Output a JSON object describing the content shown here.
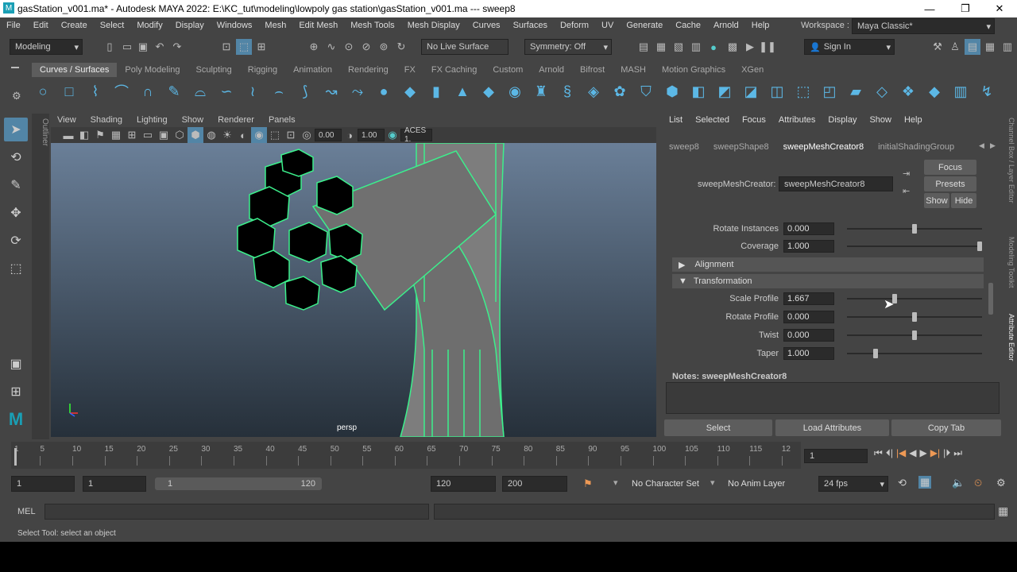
{
  "window": {
    "title": "gasStation_v001.ma* - Autodesk MAYA 2022: E:\\KC_tut\\modeling\\lowpoly gas station\\gasStation_v001.ma  ---  sweep8",
    "minimize": "—",
    "maximize": "❐",
    "close": "✕"
  },
  "menubar": [
    "File",
    "Edit",
    "Create",
    "Select",
    "Modify",
    "Display",
    "Windows",
    "Mesh",
    "Edit Mesh",
    "Mesh Tools",
    "Mesh Display",
    "Curves",
    "Surfaces",
    "Deform",
    "UV",
    "Generate",
    "Cache",
    "Arnold",
    "Help"
  ],
  "workspace": {
    "label": "Workspace :",
    "value": "Maya Classic*"
  },
  "statusline": {
    "menuset": "Modeling",
    "live_surface": "No Live Surface",
    "symmetry": "Symmetry: Off",
    "sign_in": "Sign In"
  },
  "shelf": {
    "tabs": [
      "Curves / Surfaces",
      "Poly Modeling",
      "Sculpting",
      "Rigging",
      "Animation",
      "Rendering",
      "FX",
      "FX Caching",
      "Custom",
      "Arnold",
      "Bifrost",
      "MASH",
      "Motion Graphics",
      "XGen"
    ],
    "active_tab": 0
  },
  "toolbox": {
    "tools": [
      "select-tool",
      "lasso-tool",
      "paint-select-tool",
      "move-tool",
      "rotate-tool",
      "scale-tool"
    ],
    "outliner_label": "Outliner"
  },
  "viewport": {
    "menu": [
      "View",
      "Shading",
      "Lighting",
      "Show",
      "Renderer",
      "Panels"
    ],
    "gamma": "0.00",
    "exposure": "1.00",
    "color_space": "ACES 1.",
    "camera_label": "persp",
    "wire_color": "#3cf08c"
  },
  "attribute_editor": {
    "menu": [
      "List",
      "Selected",
      "Focus",
      "Attributes",
      "Display",
      "Show",
      "Help"
    ],
    "tabs": [
      "sweep8",
      "sweepShape8",
      "sweepMeshCreator8",
      "initialShadingGroup"
    ],
    "active_tab": 2,
    "node_label": "sweepMeshCreator:",
    "node_name": "sweepMeshCreator8",
    "buttons": {
      "focus": "Focus",
      "presets": "Presets",
      "show": "Show",
      "hide": "Hide"
    },
    "attributes_top": [
      {
        "label": "Rotate Instances",
        "value": "0.000",
        "slider": 0.5
      },
      {
        "label": "Coverage",
        "value": "1.000",
        "slider": 1.0
      }
    ],
    "sections": {
      "alignment": "Alignment",
      "transformation": "Transformation"
    },
    "transformation": [
      {
        "label": "Scale Profile",
        "value": "1.667",
        "slider": 0.35
      },
      {
        "label": "Rotate Profile",
        "value": "0.000",
        "slider": 0.5
      },
      {
        "label": "Twist",
        "value": "0.000",
        "slider": 0.5
      },
      {
        "label": "Taper",
        "value": "1.000",
        "slider": 0.2
      }
    ],
    "notes_label": "Notes:  sweepMeshCreator8",
    "bottom_buttons": [
      "Select",
      "Load Attributes",
      "Copy Tab"
    ],
    "side_tabs": [
      "Channel Box / Layer Editor",
      "Modeling Toolkit",
      "Attribute Editor"
    ]
  },
  "timeline": {
    "ticks": [
      "1",
      "5",
      "10",
      "15",
      "20",
      "25",
      "30",
      "35",
      "40",
      "45",
      "50",
      "55",
      "60",
      "65",
      "70",
      "75",
      "80",
      "85",
      "90",
      "95",
      "100",
      "105",
      "110",
      "115",
      "12"
    ],
    "current_frame": "1"
  },
  "range": {
    "start": "1",
    "playback_start": "1",
    "slider_start": "1",
    "slider_end": "120",
    "playback_end": "120",
    "end": "200",
    "character_set": "No Character Set",
    "anim_layer": "No Anim Layer",
    "fps": "24 fps"
  },
  "command_line": {
    "lang": "MEL"
  },
  "help_line": "Select Tool: select an object"
}
